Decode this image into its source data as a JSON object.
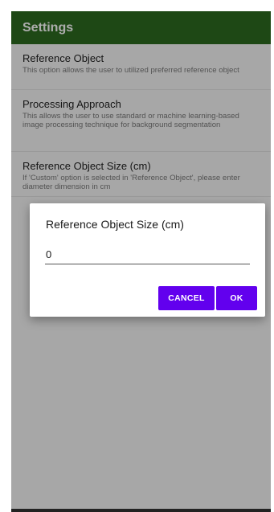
{
  "appbar": {
    "title": "Settings"
  },
  "preferences": [
    {
      "title": "Reference Object",
      "summary": "This option allows the user to utilized preferred reference object"
    },
    {
      "title": "Processing Approach",
      "summary": "This allows the user to use standard or machine learning-based image processing technique for background segmentation"
    },
    {
      "title": "Reference Object Size (cm)",
      "summary": "If 'Custom' option is selected in 'Reference Object', please enter diameter dimension in cm"
    }
  ],
  "dialog": {
    "title": "Reference Object Size (cm)",
    "value": "0",
    "cancel_label": "CANCEL",
    "ok_label": "OK"
  },
  "colors": {
    "appbar": "#2d6a1f",
    "button": "#6200ee"
  }
}
